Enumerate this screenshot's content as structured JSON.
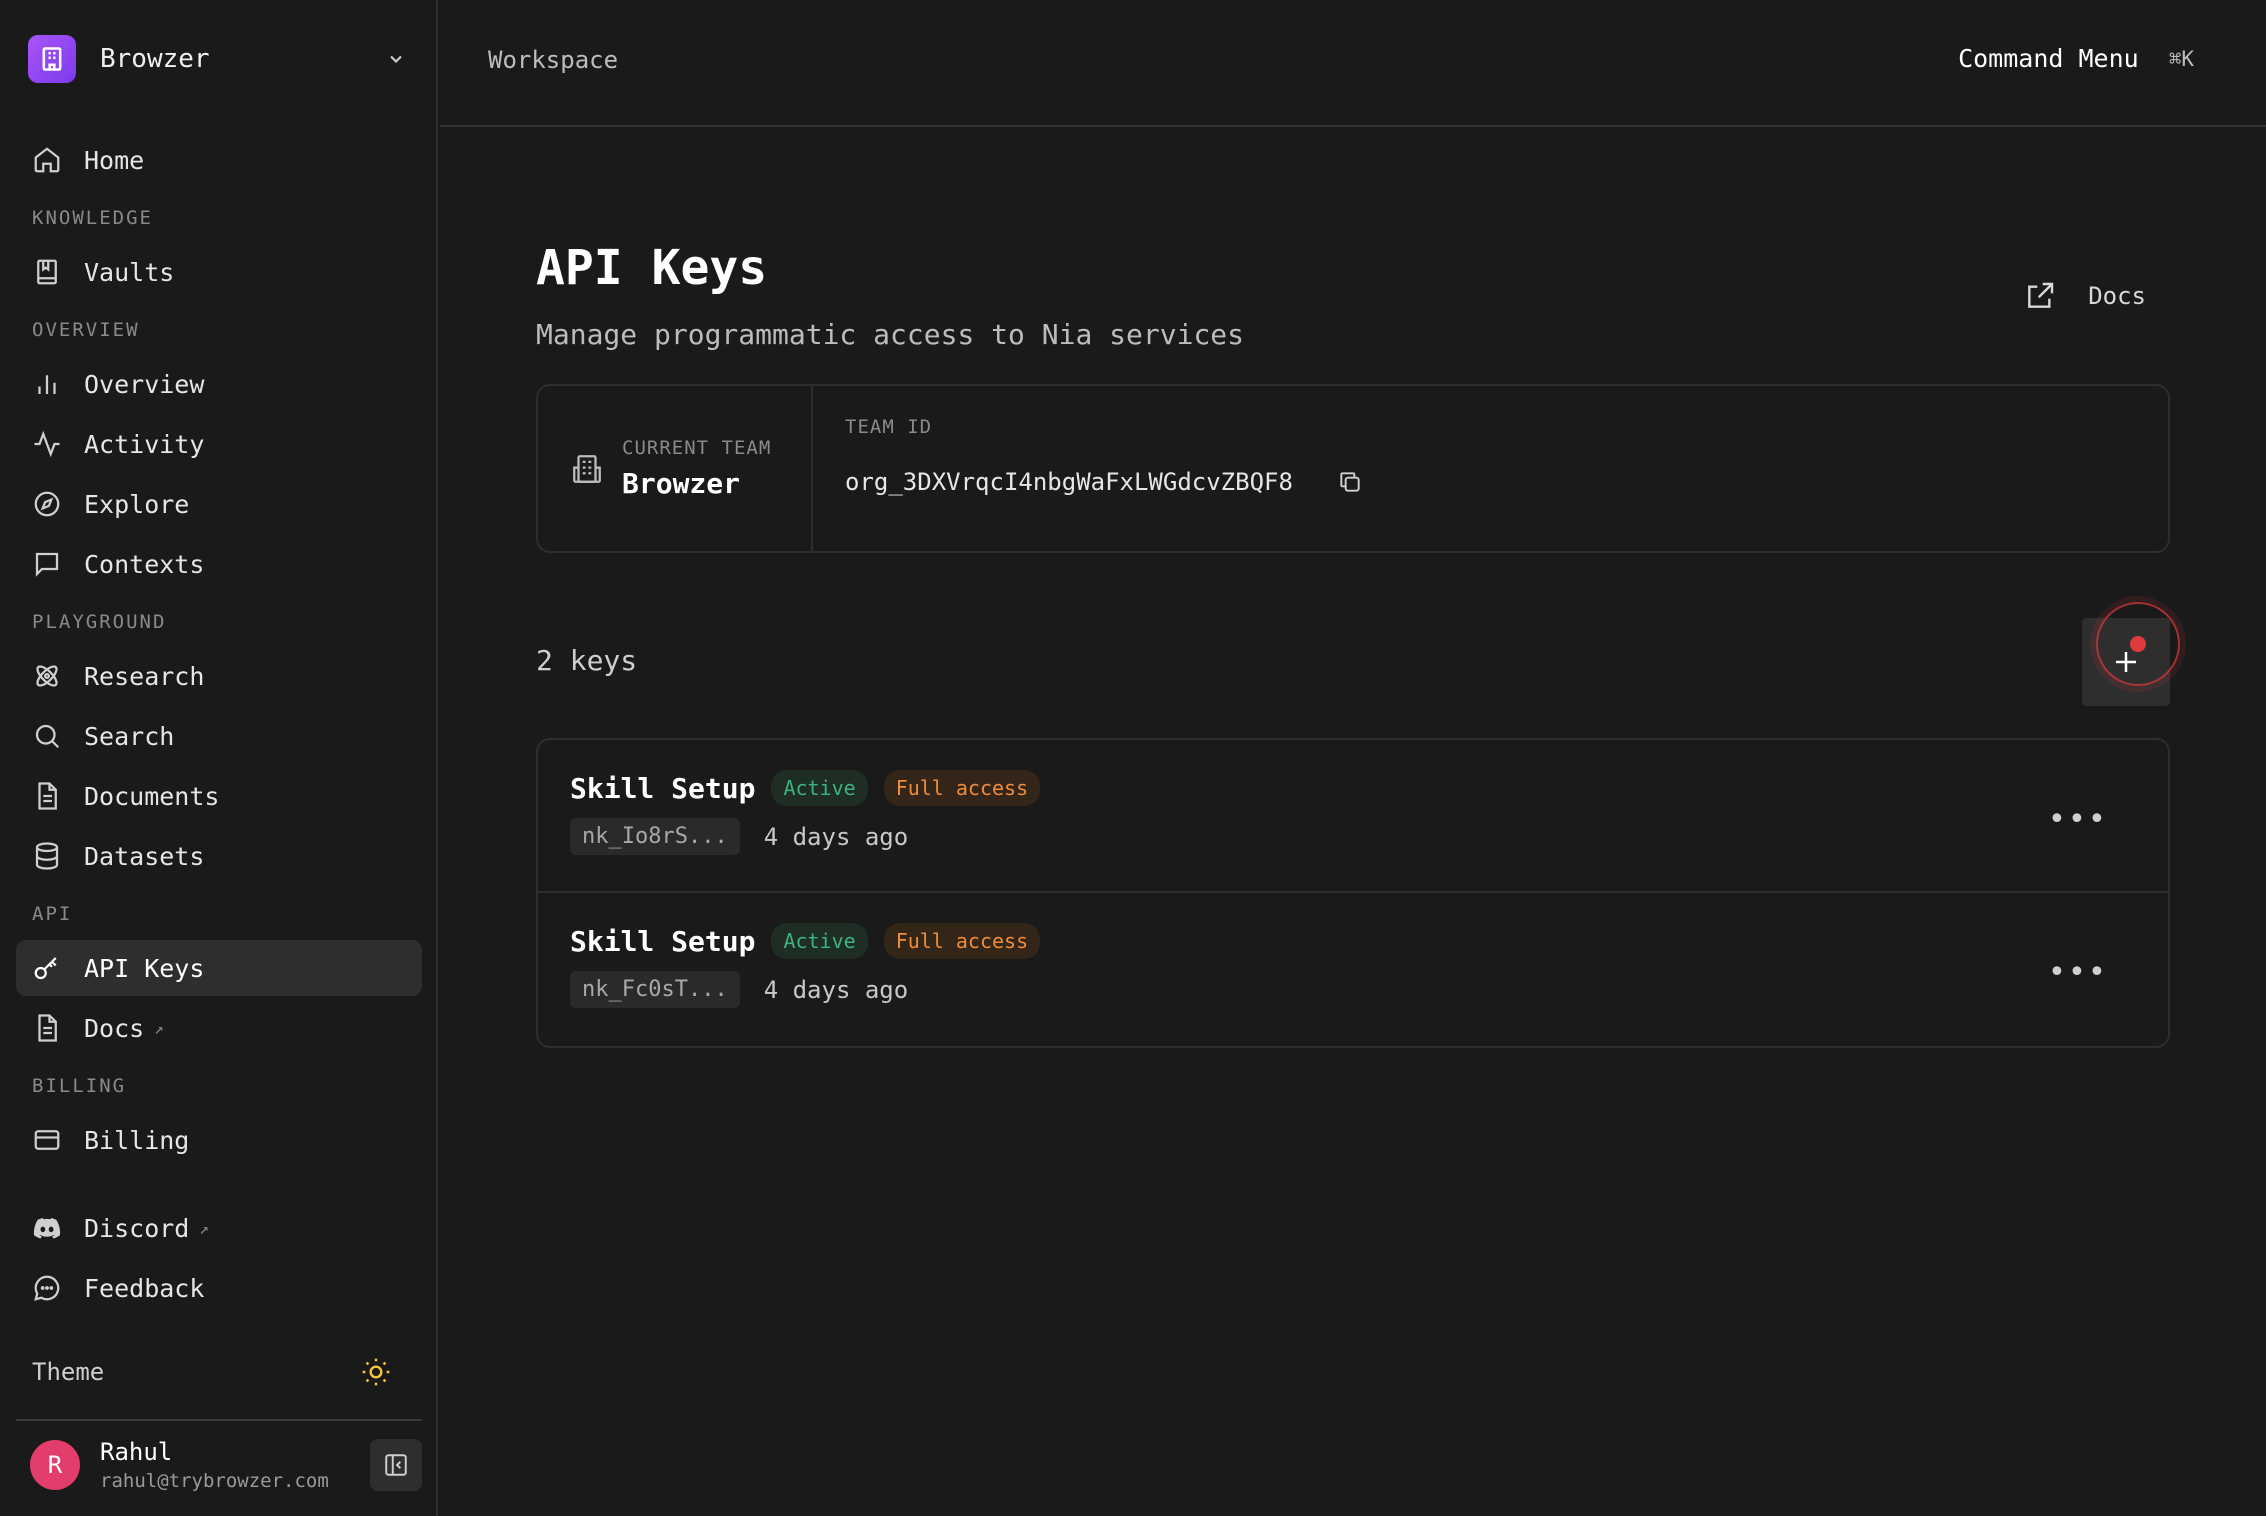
{
  "workspace": {
    "name": "Browzer"
  },
  "sidebar": {
    "items": [
      {
        "type": "item",
        "label": "Home",
        "icon": "home-icon"
      },
      {
        "type": "section",
        "label": "KNOWLEDGE"
      },
      {
        "type": "item",
        "label": "Vaults",
        "icon": "book-icon"
      },
      {
        "type": "section",
        "label": "OVERVIEW"
      },
      {
        "type": "item",
        "label": "Overview",
        "icon": "bar-chart-icon"
      },
      {
        "type": "item",
        "label": "Activity",
        "icon": "activity-icon"
      },
      {
        "type": "item",
        "label": "Explore",
        "icon": "compass-icon"
      },
      {
        "type": "item",
        "label": "Contexts",
        "icon": "message-square-icon"
      },
      {
        "type": "section",
        "label": "PLAYGROUND"
      },
      {
        "type": "item",
        "label": "Research",
        "icon": "atom-icon"
      },
      {
        "type": "item",
        "label": "Search",
        "icon": "search-icon"
      },
      {
        "type": "item",
        "label": "Documents",
        "icon": "file-text-icon"
      },
      {
        "type": "item",
        "label": "Datasets",
        "icon": "database-icon"
      },
      {
        "type": "section",
        "label": "API"
      },
      {
        "type": "item",
        "label": "API Keys",
        "icon": "key-icon",
        "active": true
      },
      {
        "type": "item",
        "label": "Docs",
        "icon": "file-text-icon",
        "external": true
      },
      {
        "type": "section",
        "label": "BILLING"
      },
      {
        "type": "item",
        "label": "Billing",
        "icon": "credit-card-icon"
      }
    ],
    "footer_items": [
      {
        "label": "Discord",
        "icon": "discord-icon",
        "external": true
      },
      {
        "label": "Feedback",
        "icon": "message-circle-icon"
      }
    ],
    "theme_label": "Theme",
    "theme_icon": "sun-icon",
    "external_glyph": "↗"
  },
  "user": {
    "initial": "R",
    "name": "Rahul",
    "email": "rahul@trybrowzer.com"
  },
  "topbar": {
    "breadcrumb": "Workspace",
    "command_label": "Command Menu",
    "command_shortcut": "⌘K"
  },
  "page": {
    "title": "API Keys",
    "subtitle": "Manage programmatic access to Nia services",
    "docs_label": "Docs"
  },
  "team": {
    "current_label": "CURRENT TEAM",
    "current_value": "Browzer",
    "id_label": "TEAM ID",
    "id_value": "org_3DXVrqcI4nbgWaFxLWGdcvZBQF8"
  },
  "keys": {
    "count_label": "2 keys",
    "items": [
      {
        "name": "Skill Setup",
        "status": "Active",
        "access": "Full access",
        "prefix": "nk_Io8rS...",
        "age": "4 days ago"
      },
      {
        "name": "Skill Setup",
        "status": "Active",
        "access": "Full access",
        "prefix": "nk_Fc0sT...",
        "age": "4 days ago"
      }
    ],
    "more_glyph": "•••"
  },
  "colors": {
    "background": "#1a1a1a",
    "accent_purple": "#a855f7",
    "active_badge": "#3fb27f",
    "full_access_badge": "#f08c3a",
    "avatar": "#e23d6b",
    "target": "#e0393e",
    "theme_sun": "#f5c542"
  }
}
